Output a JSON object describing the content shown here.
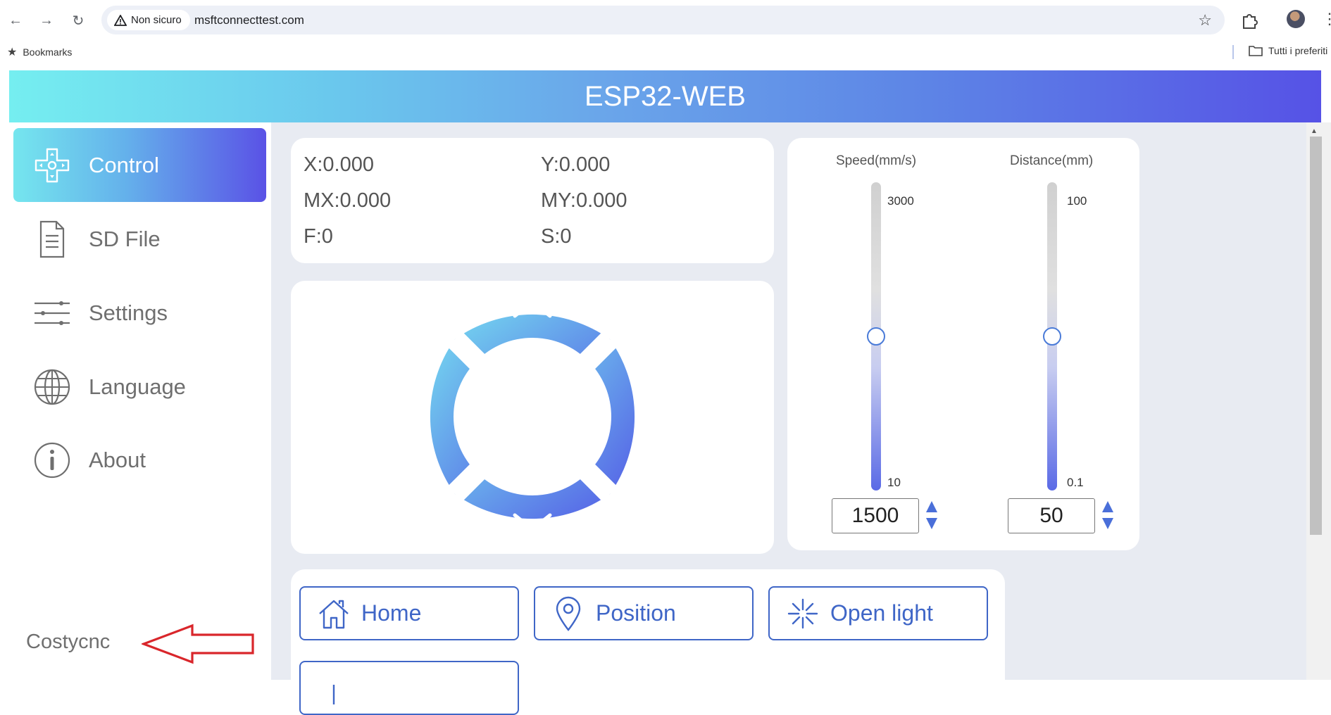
{
  "browser": {
    "security_label": "Non sicuro",
    "url": "msftconnecttest.com",
    "bookmarks_label": "Bookmarks",
    "all_bookmarks_label": "Tutti i preferiti"
  },
  "app": {
    "title": "ESP32-WEB",
    "brand": "Costycnc"
  },
  "sidebar": {
    "items": [
      {
        "label": "Control",
        "icon": "dpad-icon"
      },
      {
        "label": "SD File",
        "icon": "document-icon"
      },
      {
        "label": "Settings",
        "icon": "sliders-icon"
      },
      {
        "label": "Language",
        "icon": "globe-icon"
      },
      {
        "label": "About",
        "icon": "info-icon"
      }
    ]
  },
  "status": {
    "x": "X:0.000",
    "y": "Y:0.000",
    "mx": "MX:0.000",
    "my": "MY:0.000",
    "f": "F:0",
    "s": "S:0"
  },
  "speed": {
    "title": "Speed(mm/s)",
    "max": "3000",
    "min": "10",
    "value": "1500"
  },
  "distance": {
    "title": "Distance(mm)",
    "max": "100",
    "min": "0.1",
    "value": "50"
  },
  "actions": {
    "home": "Home",
    "position": "Position",
    "open_light": "Open light"
  },
  "colors": {
    "accent": "#3f66c7",
    "annotation_arrow": "#d9262b"
  }
}
